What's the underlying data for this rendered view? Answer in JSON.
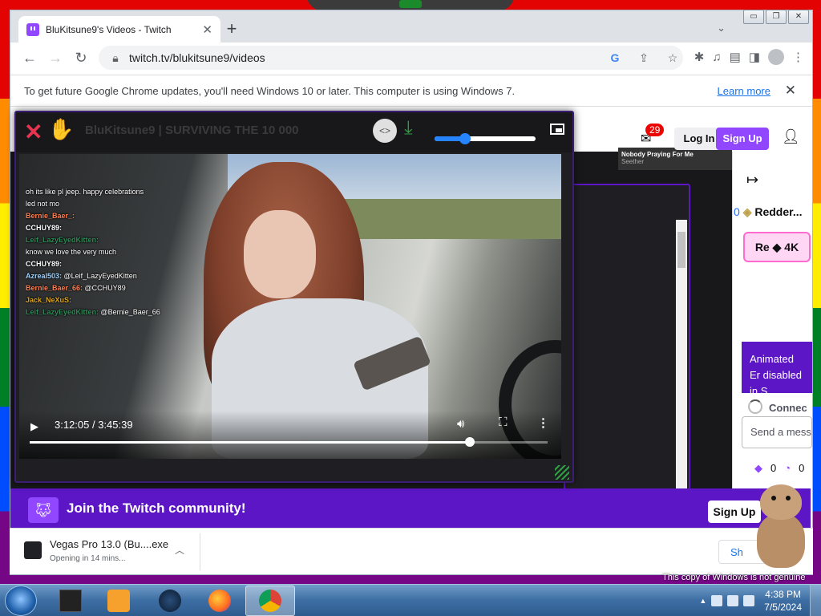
{
  "browser": {
    "tab_title": "BluKitsune9's Videos - Twitch",
    "url": "twitch.tv/blukitsune9/videos",
    "infobar_text": "To get future Google Chrome updates, you'll need Windows 10 or later. This computer is using Windows 7.",
    "infobar_link": "Learn more"
  },
  "twitch": {
    "notification_count": "29",
    "login": "Log In",
    "signup": "Sign Up",
    "thumbnail_title": "Nobody Praying For Me",
    "thumbnail_sub": "Seether",
    "sidebar_num": "0",
    "sidebar_name": "Redder...",
    "reward_label": "Re",
    "reward_value": "4K",
    "animated_notice": "Animated Er disabled in S",
    "connecting": "Connec",
    "send_placeholder": "Send a mess",
    "points_a": "0",
    "points_b": "0",
    "join_text": "Join the Twitch community!",
    "join_signup": "Sign Up"
  },
  "player": {
    "title": "BluKitsune9 | SURVIVING THE 10 000",
    "time": "3:12:05 / 3:45:39",
    "progress": 0.85,
    "volume": 0.3
  },
  "chat_overlay": [
    {
      "user": "",
      "text": "oh its like pl jeep. happy celebrations",
      "color": "#ffffff"
    },
    {
      "user": "",
      "text": "",
      "color": "#9fd4ff"
    },
    {
      "user": "",
      "text": "",
      "color": "#ffffff"
    },
    {
      "user": "",
      "text": "led not mo",
      "color": "#ffffff"
    },
    {
      "user": "Bernie_Baer_",
      "text": "",
      "color": "#ff7f50"
    },
    {
      "user": "CCHUY89",
      "text": "",
      "color": "#ffffff"
    },
    {
      "user": "Leif_LazyEyedKitten",
      "text": "",
      "color": "#2e8b57"
    },
    {
      "user": "",
      "text": "know we love the very much",
      "color": "#ffffff"
    },
    {
      "user": "CCHUY89",
      "text": "",
      "color": "#ffffff"
    },
    {
      "user": "Azreal503",
      "text": "@Leif_LazyEyedKitten",
      "color": "#9fd4ff"
    },
    {
      "user": "Bernie_Baer_66",
      "text": "@CCHUY89",
      "color": "#ff7f50"
    },
    {
      "user": "Jack_NeXuS",
      "text": "",
      "color": "#daa520"
    },
    {
      "user": "Leif_LazyEyedKitten",
      "text": "@Bernie_Baer_66",
      "color": "#2e8b57"
    }
  ],
  "downloads": {
    "file_name": "Vegas Pro 13.0 (Bu....exe",
    "status": "Opening in 14 mins...",
    "show_all": "Sh"
  },
  "desktop": {
    "genuine_notice": "This copy of Windows is not genuine",
    "clock_time": "4:38 PM",
    "clock_date": "7/5/2024"
  },
  "colors": {
    "twitch_purple": "#9146ff",
    "join_bar": "#5c16c5",
    "close_red": "#e8354f",
    "download_green": "#2ea043",
    "volume_blue": "#2684ff"
  },
  "icons": [
    "twitch-icon",
    "tab-close-icon",
    "new-tab-icon",
    "back-icon",
    "forward-icon",
    "reload-icon",
    "lock-icon",
    "google-icon",
    "share-icon",
    "star-icon",
    "extensions-icon",
    "media-icon",
    "reading-list-icon",
    "sidepanel-icon",
    "profile-icon",
    "menu-icon",
    "close-icon",
    "embed-icon",
    "download-icon",
    "pip-icon",
    "play-icon",
    "volume-icon",
    "fullscreen-icon",
    "more-icon"
  ]
}
